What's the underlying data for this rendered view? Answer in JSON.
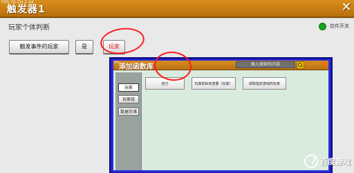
{
  "top_bar": {
    "fps_text": "FPS:70 CH 2.44",
    "title": "触发器1",
    "close_symbol": "✕"
  },
  "panel": {
    "section_title": "玩家个体判断",
    "switch_label": "控件开关",
    "buttons": {
      "trigger_player": "触发事件的玩家",
      "yes": "是",
      "player": "玩家"
    }
  },
  "dialog": {
    "tiny_text": "FPS",
    "title": "添加函数库",
    "search_placeholder": "输入搜索的内容",
    "close_symbol": "✕",
    "side_tabs": [
      "玩家",
      "玩家组",
      "数据存储"
    ],
    "functions": [
      "自己",
      "玩家的私有变量（玩家）",
      "获取指定游戏的玩家"
    ]
  },
  "watermark": {
    "text": "百度游戏"
  },
  "colors": {
    "top_bar": "#c47b13",
    "dialog_border": "#2b2ed8",
    "dialog_body": "#d9eadf",
    "annotation_red": "#ff1a1a",
    "switch_green": "#16a51f"
  },
  "icons": {
    "close": "close-icon",
    "search": "search-icon",
    "switch": "toggle-dot-icon",
    "watermark": "baidu-paw-icon"
  }
}
